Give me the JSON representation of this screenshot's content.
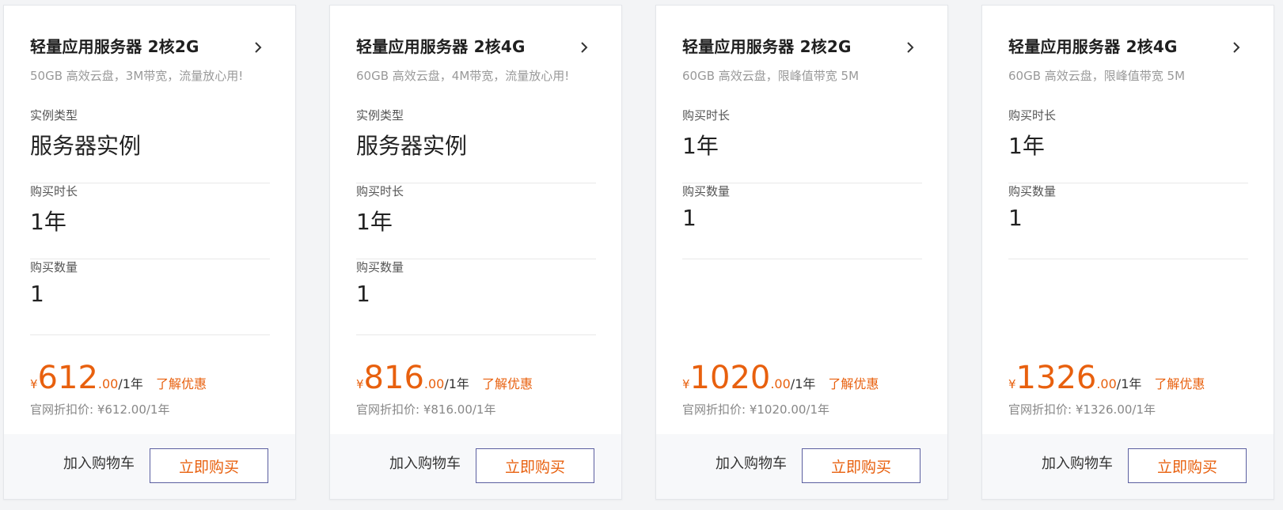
{
  "currency_symbol": "¥",
  "cart_label": "加入购物车",
  "buy_label": "立即购买",
  "promo_label": "了解优惠",
  "origin_prefix": "官网折扣价:",
  "colors": {
    "accent": "#e8600e",
    "button_border": "#5b5fa0",
    "footer_bg": "#f7f8fa"
  },
  "cards": [
    {
      "title": "轻量应用服务器 2核2G",
      "subtitle": "50GB 高效云盘，3M带宽，流量放心用!",
      "fields": [
        {
          "label": "实例类型",
          "value": "服务器实例"
        },
        {
          "label": "购买时长",
          "value": "1年"
        },
        {
          "label": "购买数量",
          "value": "1"
        }
      ],
      "price_int": "612",
      "price_dec": ".00",
      "price_unit": "/1年",
      "origin_value": "¥612.00/1年"
    },
    {
      "title": "轻量应用服务器 2核4G",
      "subtitle": "60GB 高效云盘，4M带宽，流量放心用!",
      "fields": [
        {
          "label": "实例类型",
          "value": "服务器实例"
        },
        {
          "label": "购买时长",
          "value": "1年"
        },
        {
          "label": "购买数量",
          "value": "1"
        }
      ],
      "price_int": "816",
      "price_dec": ".00",
      "price_unit": "/1年",
      "origin_value": "¥816.00/1年"
    },
    {
      "title": "轻量应用服务器 2核2G",
      "subtitle": "60GB 高效云盘，限峰值带宽 5M",
      "fields": [
        {
          "label": "购买时长",
          "value": "1年"
        },
        {
          "label": "购买数量",
          "value": "1"
        }
      ],
      "price_int": "1020",
      "price_dec": ".00",
      "price_unit": "/1年",
      "origin_value": "¥1020.00/1年"
    },
    {
      "title": "轻量应用服务器 2核4G",
      "subtitle": "60GB 高效云盘，限峰值带宽 5M",
      "fields": [
        {
          "label": "购买时长",
          "value": "1年"
        },
        {
          "label": "购买数量",
          "value": "1"
        }
      ],
      "price_int": "1326",
      "price_dec": ".00",
      "price_unit": "/1年",
      "origin_value": "¥1326.00/1年"
    }
  ]
}
